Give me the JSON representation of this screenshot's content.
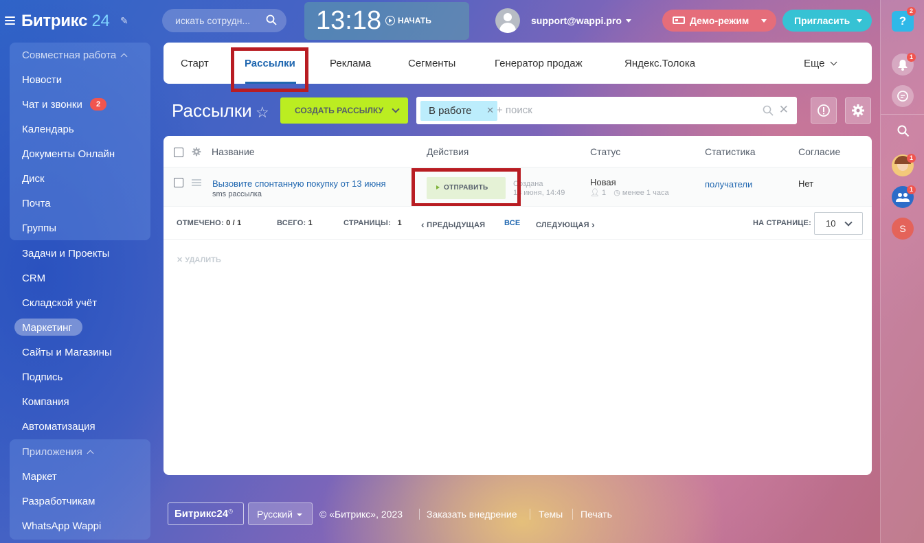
{
  "header": {
    "logo_text": "Битрикс",
    "logo_num": "24",
    "search_placeholder": "искать сотрудн...",
    "time": "13:18",
    "start_label": "НАЧАТЬ",
    "user_email": "support@wappi.pro",
    "demo_label": "Демо-режим",
    "invite_label": "Пригласить"
  },
  "right_panel": {
    "help_badge": "2",
    "notif_badge": "1",
    "avatar1_badge": "1",
    "group_badge": "1",
    "user_initial": "S"
  },
  "sidebar": {
    "group1_title": "Совместная работа",
    "items_group1": [
      "Новости",
      "Чат и звонки",
      "Календарь",
      "Документы Онлайн",
      "Диск",
      "Почта",
      "Группы"
    ],
    "chat_badge": "2",
    "items_main": [
      "Задачи и Проекты",
      "CRM",
      "Складской учёт",
      "Маркетинг",
      "Сайты и Магазины",
      "Подпись",
      "Компания",
      "Автоматизация"
    ],
    "group2_title": "Приложения",
    "items_group2": [
      "Маркет",
      "Разработчикам",
      "WhatsApp Wappi"
    ]
  },
  "tabs": [
    "Старт",
    "Рассылки",
    "Реклама",
    "Сегменты",
    "Генератор продаж",
    "Яндекс.Толока",
    "Еще"
  ],
  "page": {
    "title": "Рассылки",
    "create_button": "СОЗДАТЬ РАССЫЛКУ",
    "filter_chip": "В работе",
    "filter_placeholder": "+ поиск"
  },
  "table": {
    "columns": [
      "Название",
      "Действия",
      "Статус",
      "Статистика",
      "Согласие"
    ],
    "row": {
      "name": "Вызовите спонтанную покупку от 13 июня",
      "type": "sms рассылка",
      "action": "ОТПРАВИТЬ",
      "created_label": "Создана",
      "created_date": "13 июня, 14:49",
      "status": "Новая",
      "count": "1",
      "time_ago": "менее 1 часа",
      "stats_link": "получатели",
      "consent": "Нет"
    },
    "pager": {
      "selected_label": "ОТМЕЧЕНО:",
      "selected_value": "0 / 1",
      "total_label": "ВСЕГО:",
      "total_value": "1",
      "pages_label": "СТРАНИЦЫ:",
      "pages_value": "1",
      "prev": "ПРЕДЫДУЩАЯ",
      "all": "ВСЕ",
      "next": "СЛЕДУЮЩАЯ",
      "per_page_label": "НА СТРАНИЦЕ:",
      "per_page_value": "10"
    },
    "delete_label": "УДАЛИТЬ"
  },
  "footer": {
    "logo": "Битрикс24",
    "language": "Русский",
    "copyright": "© «Битрикс», 2023",
    "links": [
      "Заказать внедрение",
      "Темы",
      "Печать"
    ]
  }
}
